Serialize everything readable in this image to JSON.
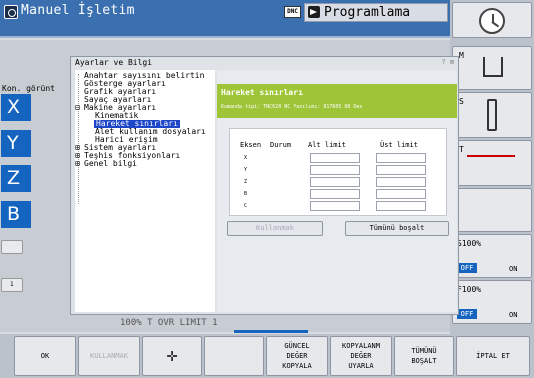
{
  "header": {
    "mode_title": "Manuel İşletim",
    "dnc_label": "DNC",
    "program_tab_label": "Programlama"
  },
  "left": {
    "konum_label": "Kon. görünt",
    "axes": [
      "X",
      "Y",
      "Z",
      "B"
    ],
    "small_label": "1"
  },
  "coord_strip": "100% T  OVR   LIMIT 1",
  "right_softkeys": {
    "m_letter": "M",
    "s_letter": "S",
    "t_letter": "T",
    "s_override": "S100%",
    "f_override": "F100%",
    "off_label": "OFF",
    "on_label": "ON"
  },
  "dialog": {
    "title": "Ayarlar ve Bilgi",
    "tree": [
      "Anahtar sayısını belirtin",
      "Gösterge ayarları",
      "Grafik ayarları",
      "Sayaç ayarları",
      "Makine ayarları",
      "Kinematik",
      "Hareket sınırları",
      "Alet kullanım dosyaları",
      "Harici erişim",
      "Sistem ayarları",
      "Teşhis fonksiyonları",
      "Genel bilgi"
    ],
    "panel": {
      "title": "Hareket sınırları",
      "subtitle": "Kumanda tipi: TNC620      NC Yazılımı: 817605 08 Dev",
      "columns": [
        "Eksen",
        "Durum",
        "Alt limit",
        "Üst limit"
      ],
      "rows": [
        "X",
        "Y",
        "Z",
        "B",
        "C"
      ],
      "button_apply": "Kullanmak",
      "button_clear_all": "Tümünü boşalt"
    }
  },
  "bottom_softkeys": {
    "ok": "OK",
    "apply": "KULLANMAK",
    "current_copy": "GÜNCEL\nDEĞER\nKOPYALA",
    "copied_apply": "KOPYALANM\nDEĞER\nUYARLA",
    "clear_all": "TÜMÜNÜ\nBOŞALT",
    "cancel": "İPTAL ET"
  }
}
